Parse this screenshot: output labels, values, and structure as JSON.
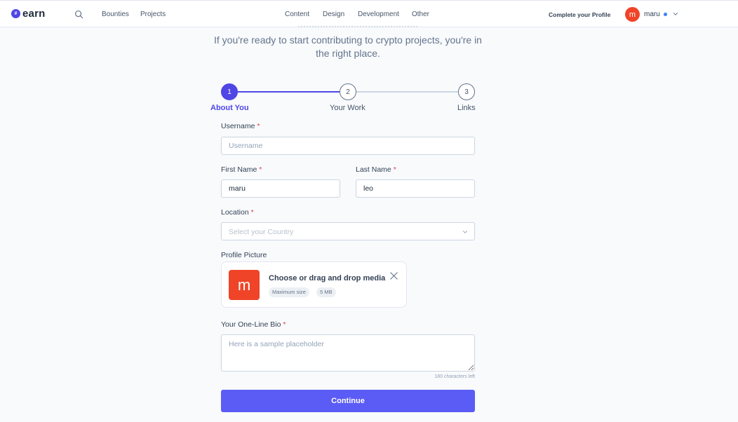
{
  "brand": {
    "logo_text": "earn",
    "accent": "#4f46e5"
  },
  "navbar": {
    "links": [
      "Bounties",
      "Projects"
    ],
    "categories": [
      "Content",
      "Design",
      "Development",
      "Other"
    ],
    "complete_profile": "Complete your Profile",
    "user": {
      "initial": "m",
      "name": "maru",
      "avatar_color": "#ef4428"
    }
  },
  "intro": {
    "text": "If you're ready to start contributing to crypto projects, you're in the right place."
  },
  "stepper": {
    "steps": [
      {
        "number": "1",
        "label": "About You",
        "active": true
      },
      {
        "number": "2",
        "label": "Your Work",
        "active": false
      },
      {
        "number": "3",
        "label": "Links",
        "active": false
      }
    ]
  },
  "form": {
    "username": {
      "label": "Username",
      "placeholder": "Username",
      "value": ""
    },
    "first_name": {
      "label": "First Name",
      "value": "maru"
    },
    "last_name": {
      "label": "Last Name",
      "value": "leo"
    },
    "location": {
      "label": "Location",
      "placeholder": "Select your Country"
    },
    "profile_picture": {
      "label": "Profile Picture",
      "initial": "m",
      "title": "Choose or drag and drop media",
      "chip_label": "Maximum size",
      "chip_value": "5 MB"
    },
    "bio": {
      "label": "Your One-Line Bio",
      "placeholder": "Here is a sample placeholder",
      "char_count": "180 characters left"
    },
    "required_mark": "*",
    "continue_label": "Continue"
  }
}
